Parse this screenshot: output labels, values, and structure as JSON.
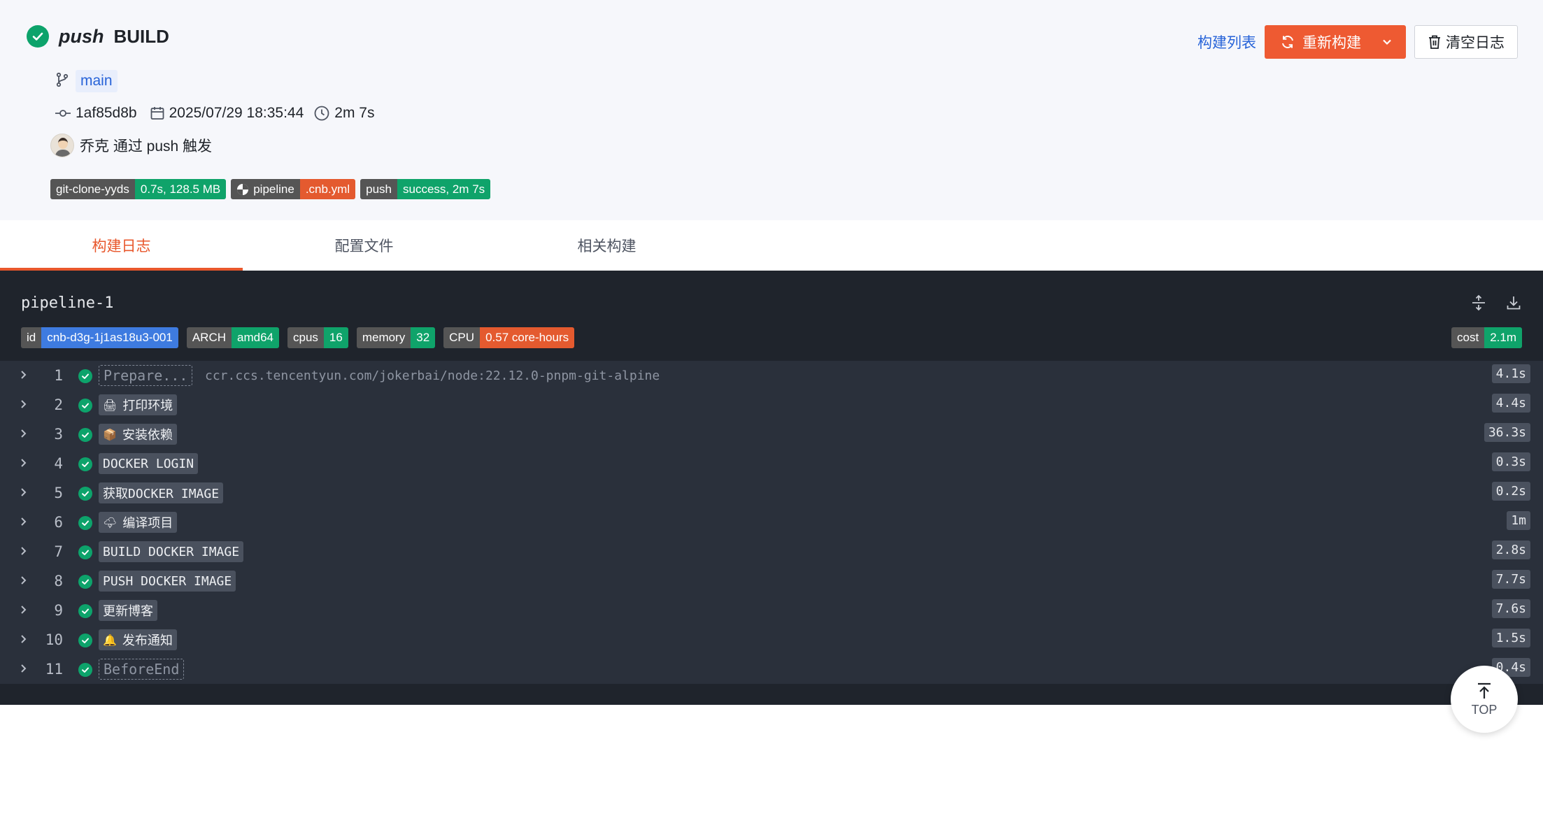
{
  "header": {
    "event": "push",
    "title": "BUILD",
    "branch": "main",
    "commit": "1af85d8b",
    "datetime": "2025/07/29 18:35:44",
    "duration": "2m 7s",
    "trigger_text": "乔克 通过 push 触发",
    "badges": [
      {
        "label": "git-clone-yyds",
        "value": "0.7s, 128.5 MB",
        "value_color": "#0fa36a"
      },
      {
        "label": "pipeline",
        "value": ".cnb.yml",
        "value_color": "#e45a2f",
        "icon": "cnb-logo-icon"
      },
      {
        "label": "push",
        "value": "success, 2m 7s",
        "value_color": "#0fa36a"
      }
    ]
  },
  "actions": {
    "build_list": "构建列表",
    "rebuild": "重新构建",
    "clear_log": "清空日志"
  },
  "tabs": [
    {
      "label": "构建日志",
      "active": true
    },
    {
      "label": "配置文件",
      "active": false
    },
    {
      "label": "相关构建",
      "active": false
    }
  ],
  "pipeline": {
    "name": "pipeline-1",
    "env": [
      {
        "label": "id",
        "value": "cnb-d3g-1j1as18u3-001",
        "value_color": "#3e7be0"
      },
      {
        "label": "ARCH",
        "value": "amd64",
        "value_color": "#0fa36a"
      },
      {
        "label": "cpus",
        "value": "16",
        "value_color": "#0fa36a"
      },
      {
        "label": "memory",
        "value": "32",
        "value_color": "#0fa36a"
      },
      {
        "label": "CPU",
        "value": "0.57 core-hours",
        "value_color": "#e45a2f"
      }
    ],
    "cost": {
      "label": "cost",
      "value": "2.1m",
      "value_color": "#0fa36a"
    },
    "steps": [
      {
        "num": "1",
        "name": "Prepare...",
        "dashed": true,
        "image": "ccr.ccs.tencentyun.com/jokerbai/node:22.12.0-pnpm-git-alpine",
        "duration": "4.1s"
      },
      {
        "num": "2",
        "emoji": "🖨",
        "name": "打印环境",
        "duration": "4.4s"
      },
      {
        "num": "3",
        "emoji": "📦",
        "name": "安装依赖",
        "duration": "36.3s"
      },
      {
        "num": "4",
        "name": "DOCKER LOGIN",
        "duration": "0.3s"
      },
      {
        "num": "5",
        "name": "获取DOCKER IMAGE",
        "duration": "0.2s"
      },
      {
        "num": "6",
        "emoji": "🌩",
        "name": "编译项目",
        "duration": "1m"
      },
      {
        "num": "7",
        "name": "BUILD DOCKER IMAGE",
        "duration": "2.8s"
      },
      {
        "num": "8",
        "name": "PUSH DOCKER IMAGE",
        "duration": "7.7s"
      },
      {
        "num": "9",
        "name": "更新博客",
        "duration": "7.6s"
      },
      {
        "num": "10",
        "emoji": "🔔",
        "name": "发布通知",
        "duration": "1.5s"
      },
      {
        "num": "11",
        "name": "BeforeEnd",
        "dashed": true,
        "duration": "0.4s"
      }
    ]
  },
  "top_button": "TOP"
}
